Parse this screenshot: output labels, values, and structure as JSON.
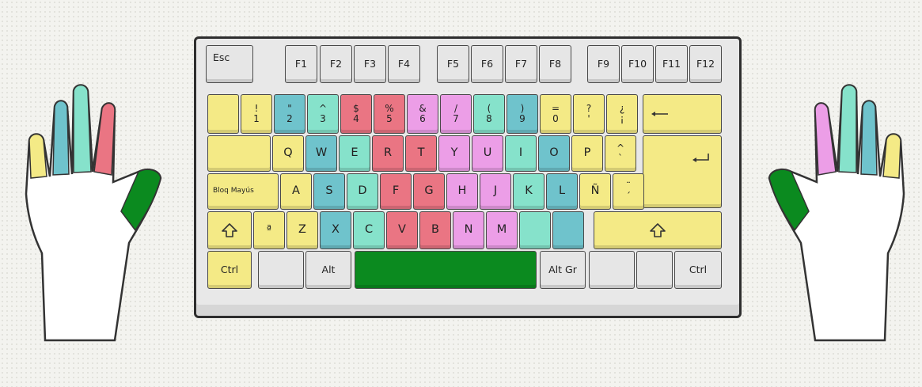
{
  "colors": {
    "yellow": "#f4ea86",
    "teal": "#6fc3cc",
    "mint": "#86e2cb",
    "red": "#ea7583",
    "pink": "#ec9ee7",
    "green": "#0b8a1f",
    "gray": "#e6e6e6"
  },
  "keys": {
    "esc": "Esc",
    "f1": "F1",
    "f2": "F2",
    "f3": "F3",
    "f4": "F4",
    "f5": "F5",
    "f6": "F6",
    "f7": "F7",
    "f8": "F8",
    "f9": "F9",
    "f10": "F10",
    "f11": "F11",
    "f12": "F12",
    "k1_top": "!",
    "k1_bot": "1",
    "k2_top": "\"",
    "k2_bot": "2",
    "k3_top": "^",
    "k3_bot": "3",
    "k4_top": "$",
    "k4_bot": "4",
    "k5_top": "%",
    "k5_bot": "5",
    "k6_top": "&",
    "k6_bot": "6",
    "k7_top": "/",
    "k7_bot": "7",
    "k8_top": "(",
    "k8_bot": "8",
    "k9_top": ")",
    "k9_bot": "9",
    "k0_top": "=",
    "k0_bot": "0",
    "kq_top": "?",
    "kq_bot": "'",
    "ki_top": "¿",
    "ki_bot": "¡",
    "q": "Q",
    "w": "W",
    "e": "E",
    "r": "R",
    "t": "T",
    "y": "Y",
    "u": "U",
    "i": "I",
    "o": "O",
    "p": "P",
    "accent_top": "^",
    "accent_bot": "`",
    "capslock": "Bloq Mayús",
    "a": "A",
    "s": "S",
    "d": "D",
    "f": "F",
    "g": "G",
    "h": "H",
    "j": "J",
    "k": "K",
    "l": "L",
    "n_tilde": "Ñ",
    "diaer_top": "¨",
    "diaer_bot": "´",
    "ordinal": "ª",
    "z": "Z",
    "x": "X",
    "c": "C",
    "v": "V",
    "b": "B",
    "n": "N",
    "m": "M",
    "ctrl": "Ctrl",
    "alt": "Alt",
    "altgr": "Alt Gr",
    "ctrl_r": "Ctrl"
  }
}
